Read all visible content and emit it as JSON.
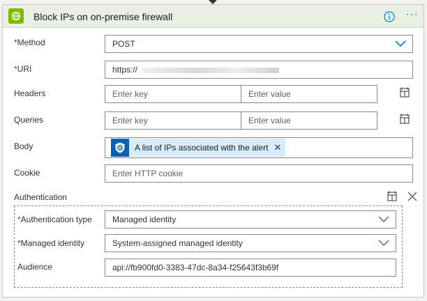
{
  "header": {
    "title": "Block IPs on on-premise firewall",
    "accent_color": "#7fba00",
    "header_bg": "#e8f0e3",
    "icon": "globe-icon"
  },
  "fields": {
    "method": {
      "label": "Method",
      "required": true,
      "value": "POST"
    },
    "uri": {
      "label": "URI",
      "required": true,
      "value": "https://"
    },
    "headers": {
      "label": "Headers",
      "key_placeholder": "Enter key",
      "value_placeholder": "Enter value"
    },
    "queries": {
      "label": "Queries",
      "key_placeholder": "Enter key",
      "value_placeholder": "Enter value"
    },
    "body": {
      "label": "Body",
      "token_text": "A list of IPs associated with the alert",
      "token_icon": "sentinel-shield-icon",
      "token_color": "#0b60b0"
    },
    "cookie": {
      "label": "Cookie",
      "placeholder": "Enter HTTP cookie"
    },
    "authentication": {
      "label": "Authentication",
      "type": {
        "label": "Authentication type",
        "required": true,
        "value": "Managed identity"
      },
      "identity": {
        "label": "Managed identity",
        "required": true,
        "value": "System-assigned managed identity"
      },
      "audience": {
        "label": "Audience",
        "value": "api://fb900fd0-3383-47dc-8a34-f25643f3b69f"
      }
    }
  },
  "required_marker": "*"
}
